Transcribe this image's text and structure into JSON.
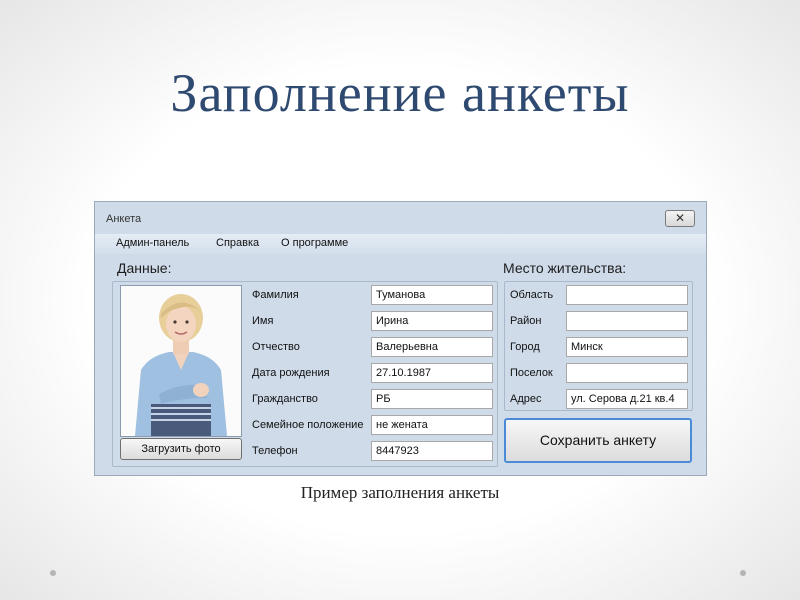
{
  "slide": {
    "title": "Заполнение анкеты",
    "caption": "Пример заполнения анкеты"
  },
  "window": {
    "title": "Анкета",
    "close_glyph": "✕",
    "menu": [
      "Админ-панель",
      "Справка",
      "О программе"
    ]
  },
  "personal": {
    "group_label": "Данные:",
    "upload_button": "Загрузить фото",
    "fields": [
      {
        "label": "Фамилия",
        "value": "Туманова"
      },
      {
        "label": "Имя",
        "value": "Ирина"
      },
      {
        "label": "Отчество",
        "value": "Валерьевна"
      },
      {
        "label": "Дата рождения",
        "value": "27.10.1987"
      },
      {
        "label": "Гражданство",
        "value": "РБ"
      },
      {
        "label": "Семейное положение",
        "value": "не жената"
      },
      {
        "label": "Телефон",
        "value": "8447923"
      }
    ]
  },
  "residence": {
    "group_label": "Место жительства:",
    "save_button": "Сохранить анкету",
    "fields": [
      {
        "label": "Область",
        "value": ""
      },
      {
        "label": "Район",
        "value": ""
      },
      {
        "label": "Город",
        "value": "Минск"
      },
      {
        "label": "Поселок",
        "value": ""
      },
      {
        "label": "Адрес",
        "value": "ул. Серова д.21 кв.4"
      }
    ]
  }
}
